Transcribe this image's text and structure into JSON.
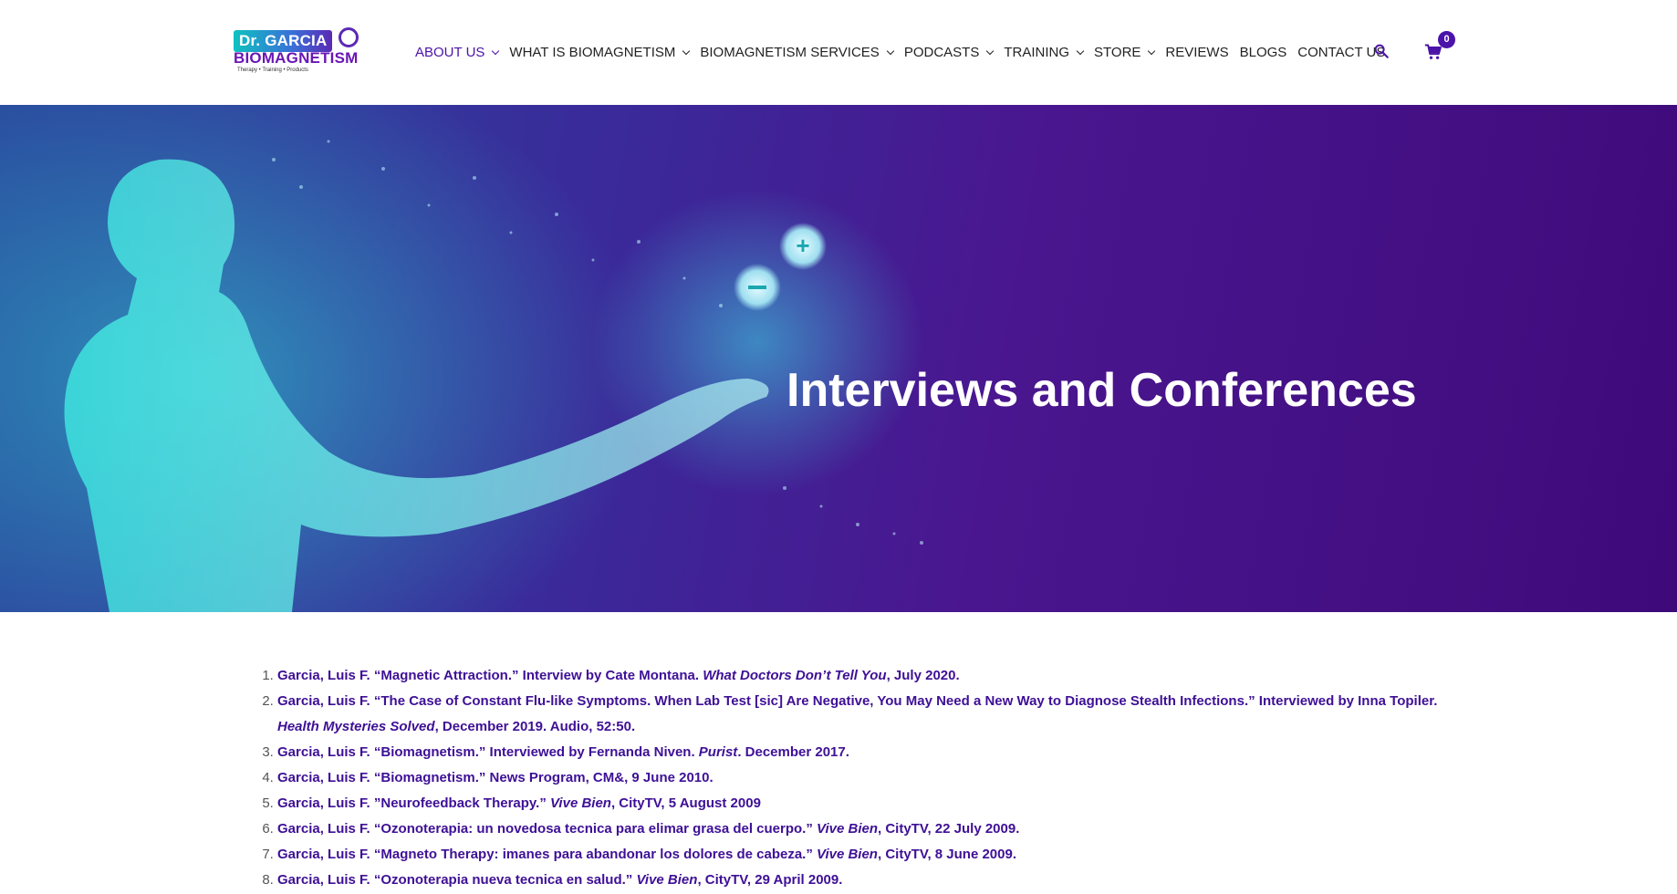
{
  "logo": {
    "line1": "Dr. GARCIA",
    "line2": "BIOMAGNETISM",
    "tagline": "Therapy • Training • Products"
  },
  "nav": {
    "items": [
      {
        "label": "ABOUT US",
        "dropdown": true,
        "active": true
      },
      {
        "label": "WHAT IS BIOMAGNETISM",
        "dropdown": true
      },
      {
        "label": "BIOMAGNETISM SERVICES",
        "dropdown": true
      },
      {
        "label": "PODCASTS",
        "dropdown": true
      },
      {
        "label": "TRAINING",
        "dropdown": true
      },
      {
        "label": "STORE",
        "dropdown": true
      },
      {
        "label": "REVIEWS",
        "dropdown": false
      },
      {
        "label": "BLOGS",
        "dropdown": false
      },
      {
        "label": "CONTACT US",
        "dropdown": false
      }
    ],
    "search_icon": "search-icon",
    "cart_icon": "shopping-cart-icon",
    "cart_count": "0"
  },
  "hero": {
    "title": "Interviews and Conferences"
  },
  "references": [
    {
      "pre": "Garcia, Luis F. “Magnetic Attraction.” Interview by Cate Montana. ",
      "em": "What Doctors Don’t Tell You",
      "post": ", July 2020."
    },
    {
      "pre": "Garcia, Luis F. “The Case of Constant Flu-like Symptoms. When Lab Test [sic] Are Negative, You May Need a New Way to Diagnose Stealth Infections.” Interviewed by Inna Topiler. ",
      "em": "Health Mysteries Solved",
      "post": ", December 2019. Audio, 52:50."
    },
    {
      "pre": "Garcia, Luis F. “Biomagnetism.” Interviewed by Fernanda Niven. ",
      "em": "Purist",
      "post": ". December 2017."
    },
    {
      "pre": "Garcia, Luis F. “Biomagnetism.” News Program, CM&, 9 June 2010.",
      "em": "",
      "post": ""
    },
    {
      "pre": "Garcia, Luis F. ”Neurofeedback Therapy.” ",
      "em": "Vive Bien",
      "post": ", CityTV, 5 August 2009"
    },
    {
      "pre": "Garcia, Luis F. “Ozonoterapia: un novedosa tecnica para elimar grasa del cuerpo.” ",
      "em": "Vive Bien",
      "post": ", CityTV, 22 July 2009."
    },
    {
      "pre": "Garcia, Luis F. “Magneto Therapy: imanes para abandonar los dolores de cabeza.” ",
      "em": "Vive Bien",
      "post": ", CityTV, 8 June 2009."
    },
    {
      "pre": "Garcia, Luis F. “Ozonoterapia nueva tecnica en salud.” ",
      "em": "Vive Bien",
      "post": ", CityTV, 29 April 2009."
    }
  ],
  "colors": {
    "accent": "#4b13a8",
    "link_text": "#3e1096",
    "hero_teal": "#2dd2d2",
    "hero_purple": "#4a168f"
  }
}
